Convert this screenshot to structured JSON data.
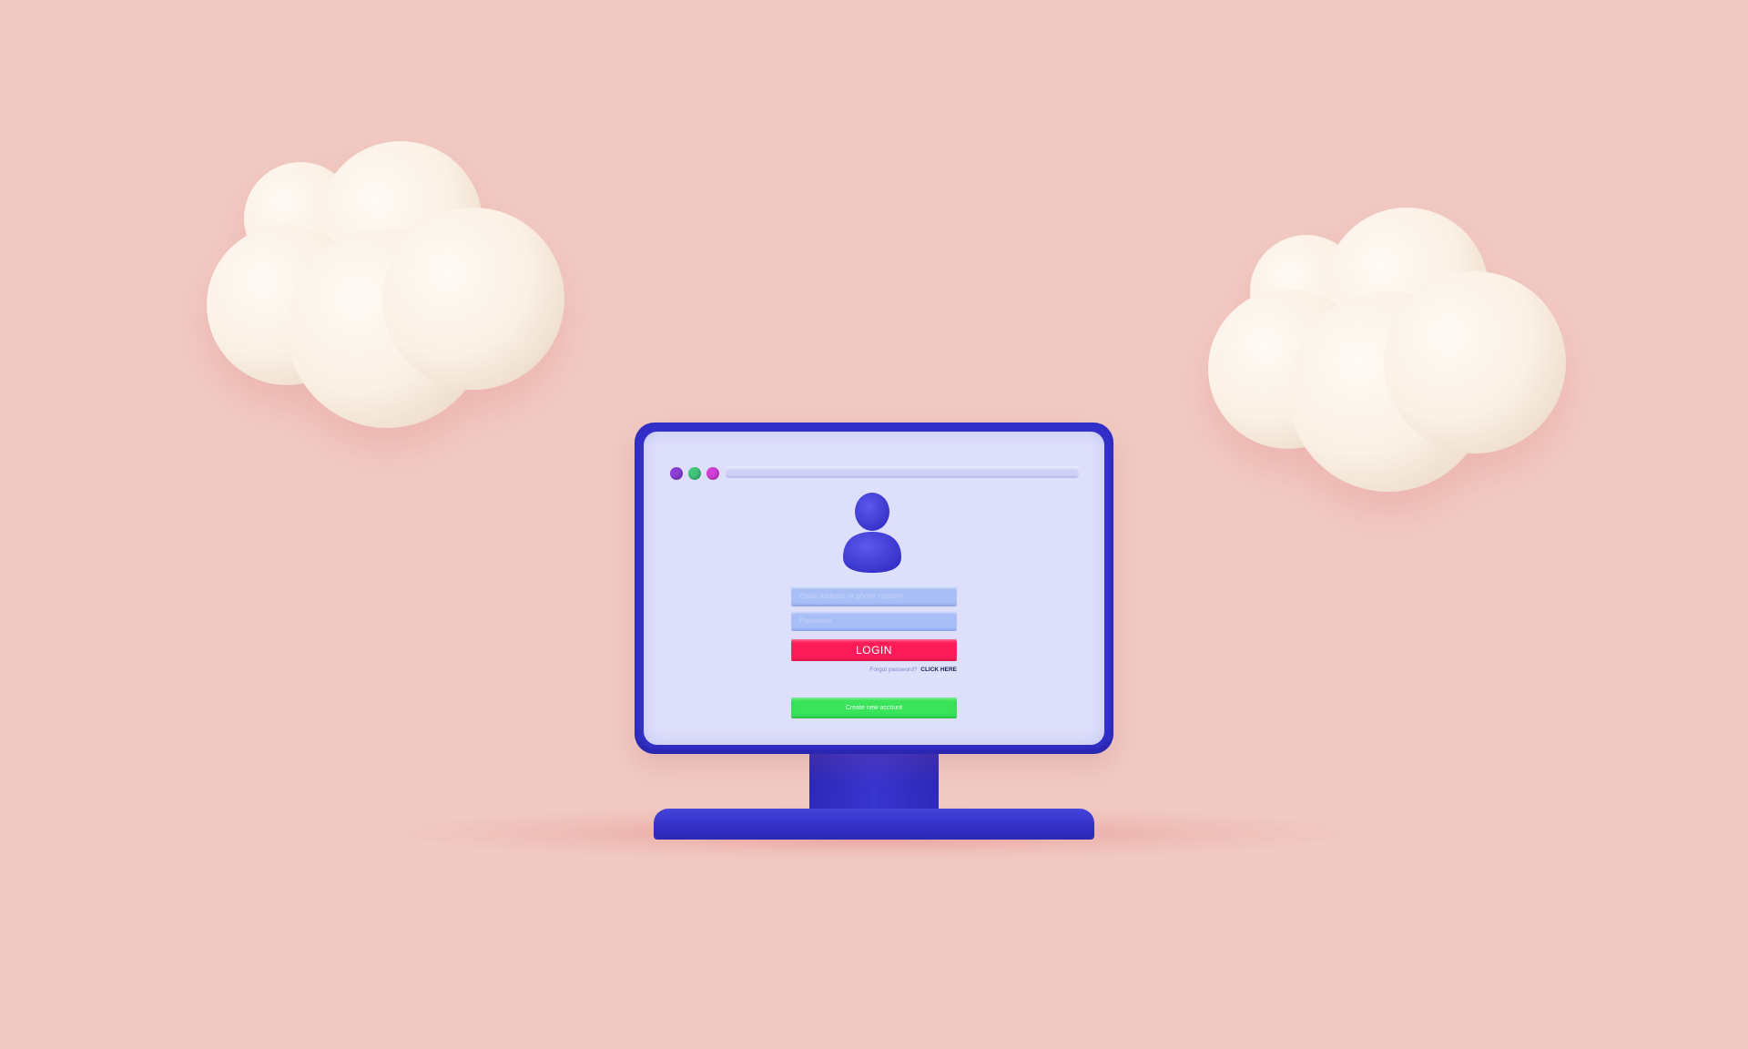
{
  "form": {
    "email_placeholder": "Email address or phone number",
    "password_placeholder": "Password",
    "login_label": "LOGIN",
    "forgot_text": "Forgot password?",
    "click_here_label": "CLICK HERE",
    "create_account_label": "Create new account"
  },
  "browser": {
    "dots": [
      "purple",
      "green",
      "pink"
    ]
  },
  "colors": {
    "background": "#f1cac3",
    "monitor": "#3330c9",
    "screen": "#dedffb",
    "avatar": "#4a45e0",
    "login_button": "#fd1c58",
    "create_button": "#39e35a",
    "input_field": "#a8bef6",
    "cloud": "#fdf3ea"
  },
  "icons": {
    "avatar": "user-icon",
    "cloud": "cloud-icon"
  }
}
